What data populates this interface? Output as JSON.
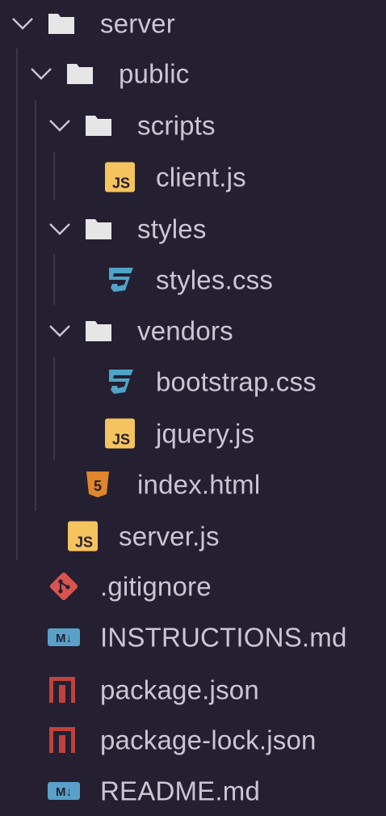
{
  "colors": {
    "background": "#241f31",
    "text": "#cac6d4",
    "indent_guide": "#3b3550",
    "folder_icon": "#e6e6e6",
    "js_icon": "#f5c45e",
    "css_icon": "#4fa3c7",
    "html_icon": "#e0862b",
    "git_icon": "#d9534f",
    "md_icon": "#5aa0c8",
    "npm_icon": "#c0423c"
  },
  "tree": {
    "items": [
      {
        "label": "server",
        "type": "folder",
        "icon": "folder-icon",
        "expanded": true,
        "depth": 0
      },
      {
        "label": "public",
        "type": "folder",
        "icon": "folder-icon",
        "expanded": true,
        "depth": 1
      },
      {
        "label": "scripts",
        "type": "folder",
        "icon": "folder-icon",
        "expanded": true,
        "depth": 2
      },
      {
        "label": "client.js",
        "type": "file",
        "icon": "javascript-icon",
        "depth": 3
      },
      {
        "label": "styles",
        "type": "folder",
        "icon": "folder-icon",
        "expanded": true,
        "depth": 2
      },
      {
        "label": "styles.css",
        "type": "file",
        "icon": "css-icon",
        "depth": 3
      },
      {
        "label": "vendors",
        "type": "folder",
        "icon": "folder-icon",
        "expanded": true,
        "depth": 2
      },
      {
        "label": "bootstrap.css",
        "type": "file",
        "icon": "css-icon",
        "depth": 3
      },
      {
        "label": "jquery.js",
        "type": "file",
        "icon": "javascript-icon",
        "depth": 3
      },
      {
        "label": "index.html",
        "type": "file",
        "icon": "html-icon",
        "depth": 2
      },
      {
        "label": "server.js",
        "type": "file",
        "icon": "javascript-icon",
        "depth": 1
      },
      {
        "label": ".gitignore",
        "type": "file",
        "icon": "git-icon",
        "depth": 0
      },
      {
        "label": "INSTRUCTIONS.md",
        "type": "file",
        "icon": "markdown-icon",
        "depth": 0
      },
      {
        "label": "package.json",
        "type": "file",
        "icon": "npm-icon",
        "depth": 0
      },
      {
        "label": "package-lock.json",
        "type": "file",
        "icon": "npm-icon",
        "depth": 0
      },
      {
        "label": "README.md",
        "type": "file",
        "icon": "markdown-icon",
        "depth": 0
      }
    ]
  },
  "icon_glyphs": {
    "js_text": "JS",
    "html_text": "5",
    "md_text": "M↓"
  }
}
